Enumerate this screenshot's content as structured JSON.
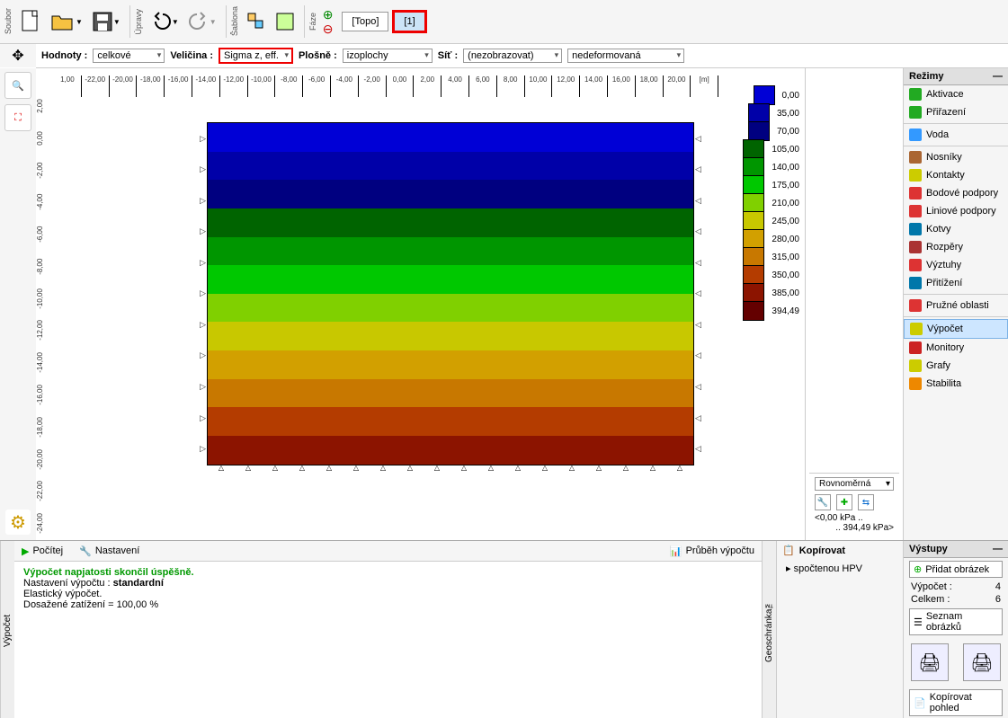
{
  "toolbar": {
    "groups": [
      "Soubor",
      "Úpravy",
      "Šablona",
      "Fáze"
    ],
    "phase_tabs": [
      "[Topo]",
      "[1]"
    ]
  },
  "options": {
    "hodnoty_lbl": "Hodnoty :",
    "hodnoty_val": "celkové",
    "velicina_lbl": "Veličina :",
    "velicina_val": "Sigma z, eff.",
    "plosne_lbl": "Plošně :",
    "plosne_val": "izoplochy",
    "sit_lbl": "Síť :",
    "sit_val": "(nezobrazovat)",
    "deform_val": "nedeformovaná"
  },
  "ruler_h": [
    "1,00",
    "-22,00",
    "-20,00",
    "-18,00",
    "-16,00",
    "-14,00",
    "-12,00",
    "-10,00",
    "-8,00",
    "-6,00",
    "-4,00",
    "-2,00",
    "0,00",
    "2,00",
    "4,00",
    "6,00",
    "8,00",
    "10,00",
    "12,00",
    "14,00",
    "16,00",
    "18,00",
    "20,00",
    "[m]"
  ],
  "ruler_v": [
    "2,00",
    "0,00",
    "-2,00",
    "-4,00",
    "-6,00",
    "-8,00",
    "-10,00",
    "-12,00",
    "-14,00",
    "-16,00",
    "-18,00",
    "-20,00",
    "-22,00",
    "-24,00"
  ],
  "chart_data": {
    "type": "heatmap",
    "quantity": "Sigma z, eff.",
    "units": "kPa",
    "x_range": [
      -14.0,
      14.0
    ],
    "y_range": [
      -20.0,
      0.0
    ],
    "legend": [
      {
        "value": "0,00",
        "color": "#0000d6"
      },
      {
        "value": "35,00",
        "color": "#0000a8"
      },
      {
        "value": "70,00",
        "color": "#000080"
      },
      {
        "value": "105,00",
        "color": "#006400"
      },
      {
        "value": "140,00",
        "color": "#009600"
      },
      {
        "value": "175,00",
        "color": "#00c800"
      },
      {
        "value": "210,00",
        "color": "#80d000"
      },
      {
        "value": "245,00",
        "color": "#c8c800"
      },
      {
        "value": "280,00",
        "color": "#d2a000"
      },
      {
        "value": "315,00",
        "color": "#c87800"
      },
      {
        "value": "350,00",
        "color": "#b43c00"
      },
      {
        "value": "385,00",
        "color": "#8c1400"
      },
      {
        "value": "394,49",
        "color": "#640000"
      }
    ],
    "bands": [
      "#0000d6",
      "#0000a8",
      "#000080",
      "#006400",
      "#009600",
      "#00c800",
      "#80d000",
      "#c8c800",
      "#d2a000",
      "#c87800",
      "#b43c00",
      "#8c1400"
    ]
  },
  "modes": {
    "title": "Režimy",
    "items": [
      "Aktivace",
      "Přiřazení",
      "Voda",
      "Nosníky",
      "Kontakty",
      "Bodové podpory",
      "Liniové podpory",
      "Kotvy",
      "Rozpěry",
      "Výztuhy",
      "Přitížení",
      "Pružné oblasti",
      "Výpočet",
      "Monitory",
      "Grafy",
      "Stabilita"
    ],
    "selected": "Výpočet",
    "icon_colors": [
      "#2a2",
      "#2a2",
      "#39f",
      "#a63",
      "#cc0",
      "#d33",
      "#d33",
      "#07a",
      "#a33",
      "#d33",
      "#07a",
      "#d33",
      "#cc0",
      "#c22",
      "#cc0",
      "#e80"
    ]
  },
  "scale": {
    "dd": "Rovnoměrná",
    "min": "<0,00 kPa ..",
    "max": ".. 394,49 kPa>"
  },
  "msgbar": {
    "pocitej": "Počítej",
    "nastaveni": "Nastavení",
    "prubeh": "Průběh výpočtu"
  },
  "messages": {
    "success": "Výpočet napjatosti skončil úspěšně.",
    "l1a": "Nastavení výpočtu : ",
    "l1b": "standardní",
    "l2": "Elastický výpočet.",
    "l3": "Dosažené zatížení = 100,00 %"
  },
  "copy": {
    "title": "Kopírovat",
    "item": "spočtenou HPV",
    "side": "Geoschránka™"
  },
  "outputs": {
    "title": "Výstupy",
    "add": "Přidat obrázek",
    "vypocet_l": "Výpočet :",
    "vypocet_v": "4",
    "celkem_l": "Celkem :",
    "celkem_v": "6",
    "list": "Seznam obrázků",
    "copyview": "Kopírovat pohled"
  },
  "side_label": "Výpočet"
}
